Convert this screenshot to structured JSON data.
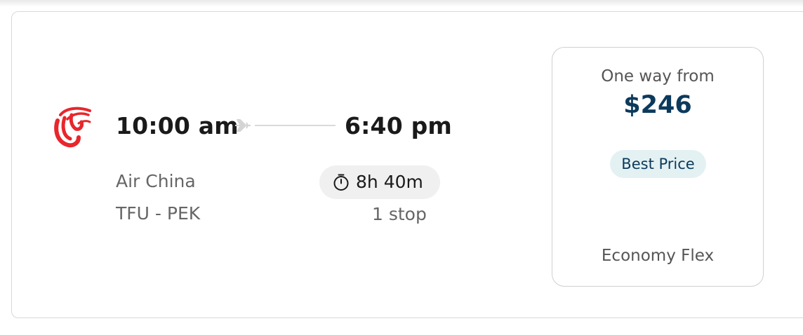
{
  "flight": {
    "departure_time": "10:00 am",
    "arrival_time": "6:40 pm",
    "airline": "Air China",
    "route": "TFU - PEK",
    "duration": "8h 40m",
    "stops": "1 stop"
  },
  "fare": {
    "label": "One way from",
    "price": "$246",
    "badge": "Best Price",
    "cabin": "Economy Flex"
  },
  "colors": {
    "logo_red": "#e8262c",
    "price_navy": "#0b3a5c",
    "badge_bg": "#e4f1f3"
  },
  "icons": {
    "airline_logo": "air-china-phoenix-logo",
    "route": "plane-icon",
    "duration": "stopwatch-icon"
  }
}
